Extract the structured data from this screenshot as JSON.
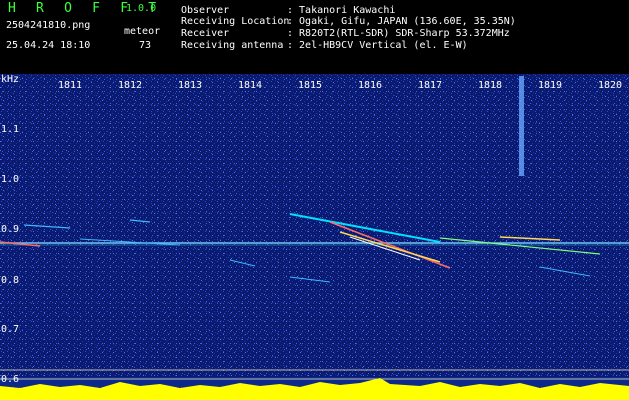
{
  "header": {
    "app_title": "H R O F F T",
    "app_version": "1.0.0",
    "file_name": "2504241810.png",
    "timestamp": "25.04.24 18:10",
    "detect_label": "meteor",
    "detect_count": "73"
  },
  "station_info": [
    {
      "label": "Observer",
      "value": ": Takanori Kawachi"
    },
    {
      "label": "Receiving Location",
      "value": ": Ogaki, Gifu, JAPAN (136.60E, 35.35N)"
    },
    {
      "label": "Receiver",
      "value": ": R820T2(RTL-SDR) SDR-Sharp 53.372MHz"
    },
    {
      "label": "Receiving antenna",
      "value": ": 2el-HB9CV Vertical (el. E-W)"
    }
  ],
  "spectrogram": {
    "y_unit": "kHz",
    "y_ticks": [
      "1.1",
      "1.0",
      "0.9",
      "0.8",
      "0.7",
      "0.6"
    ],
    "x_ticks": [
      "1811",
      "1812",
      "1813",
      "1814",
      "1815",
      "1816",
      "1817",
      "1818",
      "1819",
      "1820"
    ]
  },
  "colors": {
    "background": "#000000",
    "plot_bg": "#0a1a6e",
    "header_green": "#3cff3c",
    "header_text": "#ffffff",
    "graph_yellow": "#ffff00",
    "graph_cyan": "#00e5ff"
  }
}
